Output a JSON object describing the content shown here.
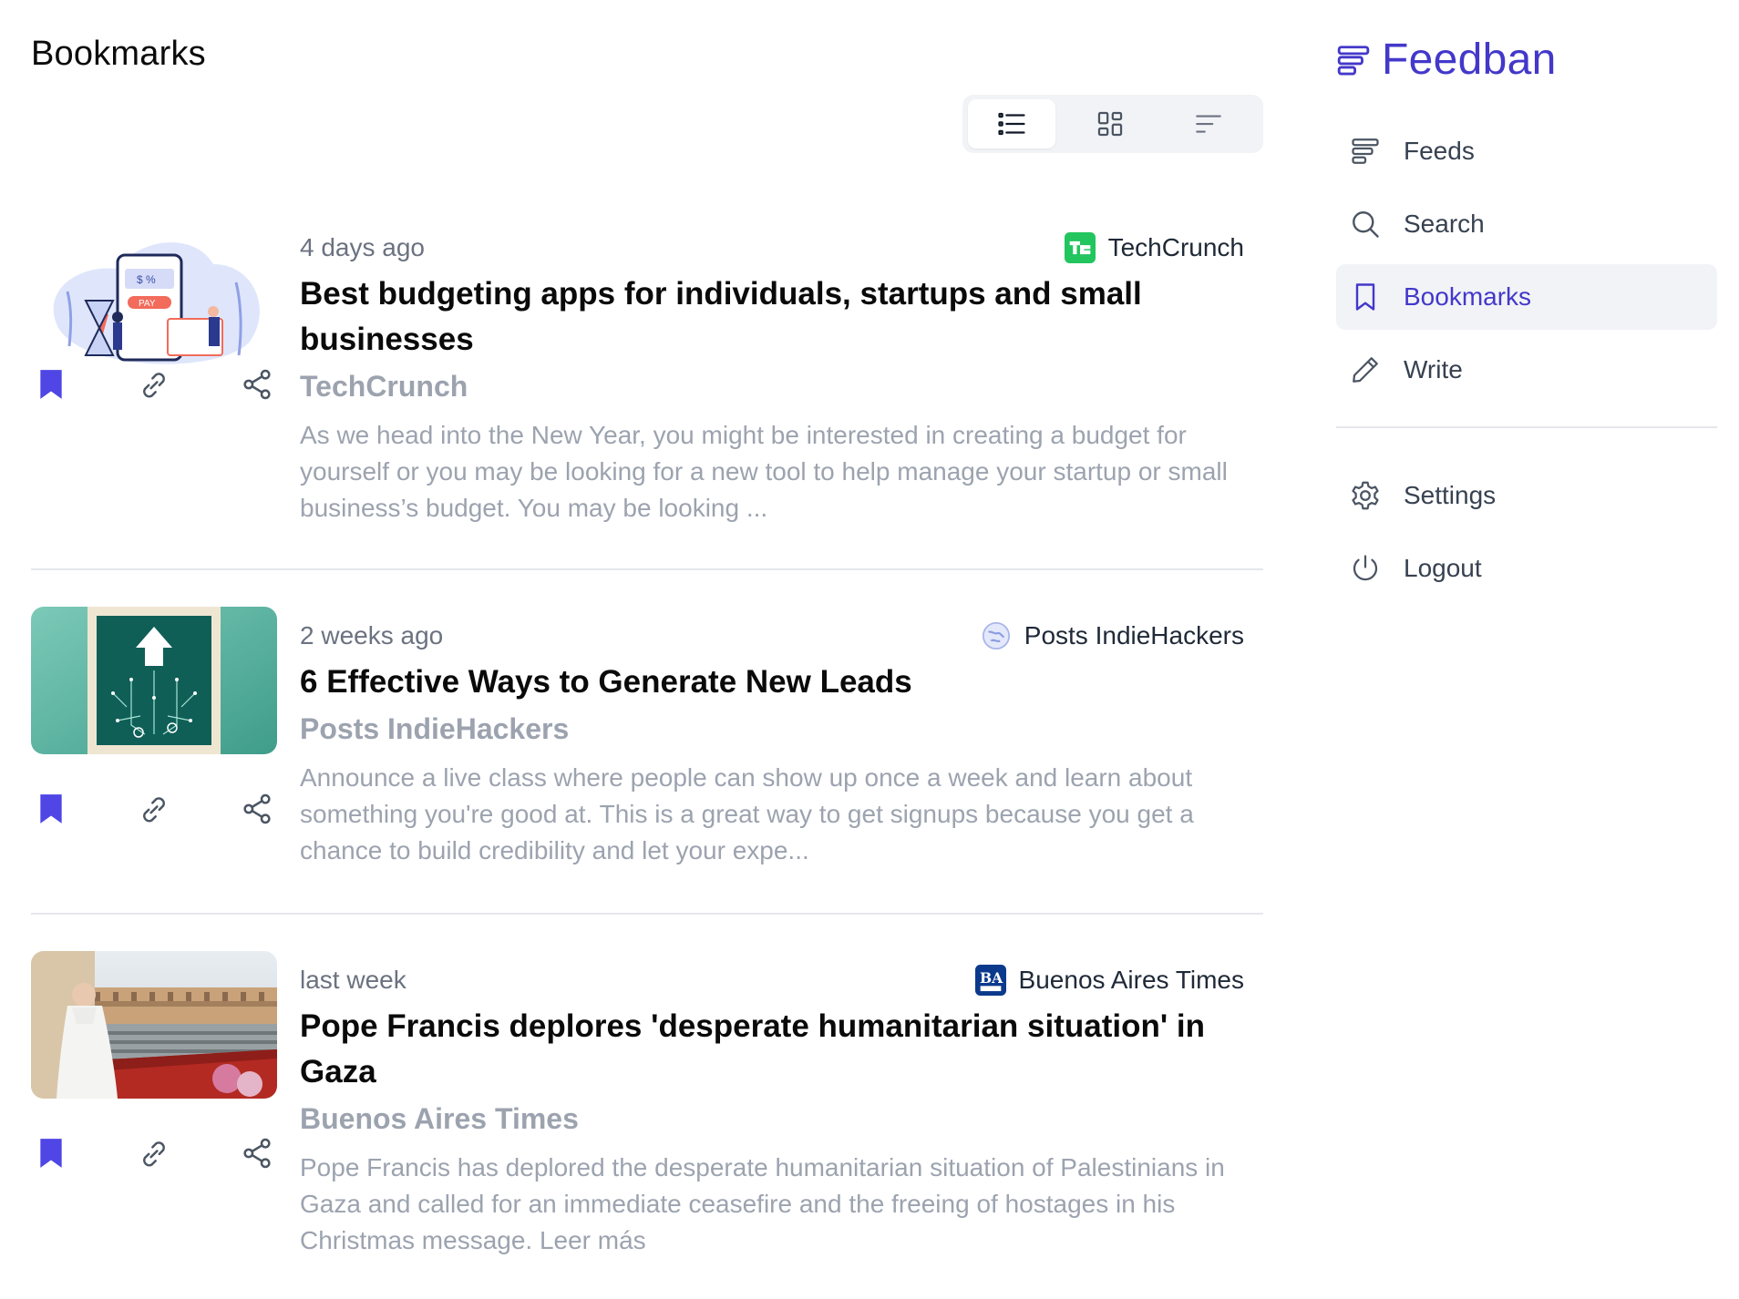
{
  "page": {
    "title": "Bookmarks"
  },
  "view_modes": [
    {
      "name": "list-view",
      "icon": "list-icon",
      "active": true
    },
    {
      "name": "grid-view",
      "icon": "grid-icon",
      "active": false
    },
    {
      "name": "compact-view",
      "icon": "compact-list-icon",
      "active": false
    }
  ],
  "articles": [
    {
      "time": "4 days ago",
      "source": "TechCrunch",
      "source_icon": "techcrunch-logo-icon",
      "headline": "Best budgeting apps for individuals, startups and small businesses",
      "feed": "TechCrunch",
      "summary": "As we head into the New Year, you might be interested in creating a budget for yourself or you may be looking for a new tool to help manage your startup or small business’s budget. You may be looking ...",
      "bookmarked": true
    },
    {
      "time": "2 weeks ago",
      "source": "Posts IndieHackers",
      "source_icon": "globe-icon",
      "headline": "6 Effective Ways to Generate New Leads",
      "feed": "Posts IndieHackers",
      "summary": "Announce a live class where people can show up once a week and learn about something you're good at. This is a great way to get signups because you get a chance to build credibility and let your expe...",
      "bookmarked": true
    },
    {
      "time": "last week",
      "source": "Buenos Aires Times",
      "source_icon": "ba-times-logo-icon",
      "headline": "Pope Francis deplores 'desperate humanitarian situation' in Gaza",
      "feed": "Buenos Aires Times",
      "summary": "Pope Francis has deplored the desperate humanitarian situation of Palestinians in Gaza and called for an immediate ceasefire and the freeing of hostages in his Christmas message. Leer más",
      "bookmarked": true
    }
  ],
  "sidebar": {
    "brand": "Feedban",
    "items": [
      {
        "label": "Feeds",
        "icon": "feeds-icon",
        "active": false
      },
      {
        "label": "Search",
        "icon": "search-icon",
        "active": false
      },
      {
        "label": "Bookmarks",
        "icon": "bookmark-icon",
        "active": true
      },
      {
        "label": "Write",
        "icon": "pencil-icon",
        "active": false
      }
    ],
    "secondary_items": [
      {
        "label": "Settings",
        "icon": "gear-icon",
        "active": false
      },
      {
        "label": "Logout",
        "icon": "power-icon",
        "active": false
      }
    ]
  },
  "colors": {
    "accent": "#4338ca",
    "bookmark": "#4f46e5",
    "muted_text": "#9ca3af",
    "divider": "#e5e7eb"
  }
}
